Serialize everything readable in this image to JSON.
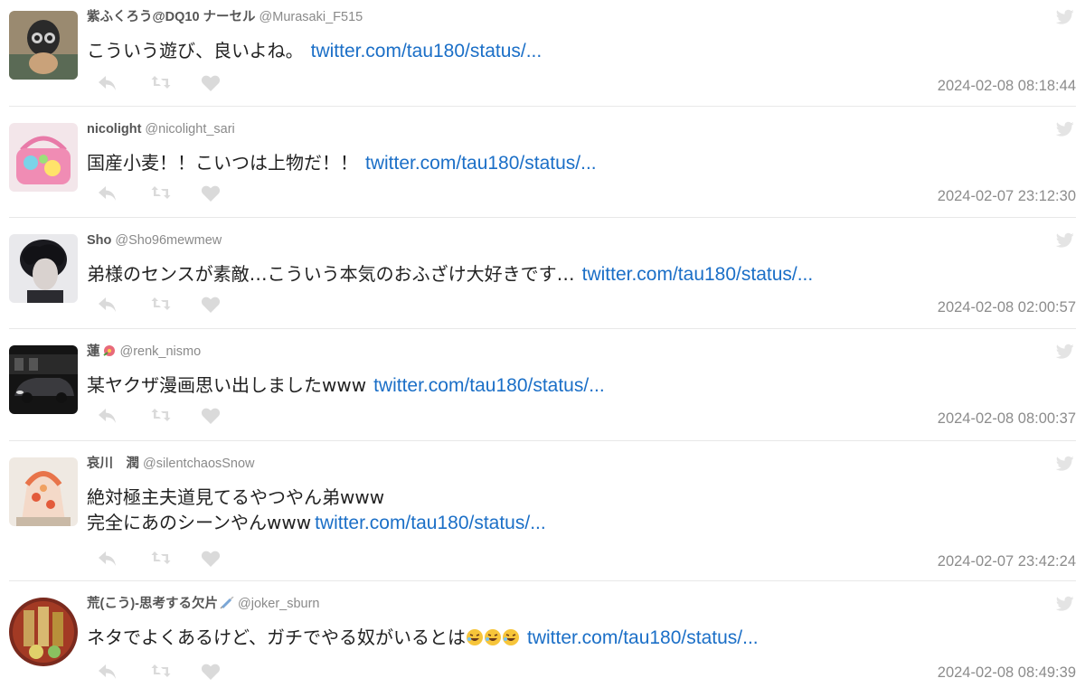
{
  "tweets": [
    {
      "name": "紫ふくろう@DQ10 ナーセル",
      "handle": "@Murasaki_F515",
      "text": "こういう遊び、良いよね。",
      "link": "twitter.com/tau180/status/...",
      "time": "2024-02-08 08:18:44"
    },
    {
      "name": "nicolight",
      "handle": "@nicolight_sari",
      "text": "国産小麦！！こいつは上物だ！！",
      "link": "twitter.com/tau180/status/...",
      "time": "2024-02-07 23:12:30"
    },
    {
      "name": "Sho",
      "handle": "@Sho96mewmew",
      "text": "弟様のセンスが素敵…こういう本気のおふざけ大好きです…",
      "link": "twitter.com/tau180/status/...",
      "time": "2024-02-08 02:00:57"
    },
    {
      "name": "蓮",
      "handle": "@renk_nismo",
      "text": "某ヤクザ漫画思い出しましたwww",
      "link": "twitter.com/tau180/status/...",
      "time": "2024-02-08 08:00:37"
    },
    {
      "name": "哀川　潤",
      "handle": "@silentchaosSnow",
      "text_line1": "絶対極主夫道見てるやつやん弟www",
      "text_line2": "完全にあのシーンやんwww",
      "link": "twitter.com/tau180/status/...",
      "time": "2024-02-07 23:42:24"
    },
    {
      "name": "荒(こう)-思考する欠片",
      "handle": "@joker_sburn",
      "text": "ネタでよくあるけど、ガチでやる奴がいるとは",
      "link": "twitter.com/tau180/status/...",
      "time": "2024-02-08 08:49:39"
    }
  ],
  "icons": {
    "reply": "reply-icon",
    "retweet": "retweet-icon",
    "like": "heart-icon",
    "platform": "twitter-bird-icon"
  },
  "colors": {
    "link": "#1b6fc7",
    "name": "#555555",
    "handle": "#8a8a8a",
    "icon": "#d9d9d9"
  }
}
